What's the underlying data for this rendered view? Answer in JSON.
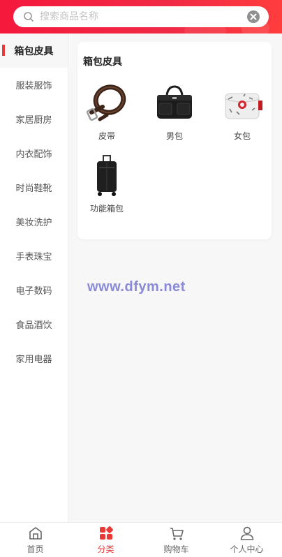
{
  "search": {
    "placeholder": "搜索商品名称",
    "value": ""
  },
  "sidebar": {
    "items": [
      {
        "label": "箱包皮具",
        "active": true
      },
      {
        "label": "服装服饰"
      },
      {
        "label": "家居厨房"
      },
      {
        "label": "内衣配饰"
      },
      {
        "label": "时尚鞋靴"
      },
      {
        "label": "美妆洗护"
      },
      {
        "label": "手表珠宝"
      },
      {
        "label": "电子数码"
      },
      {
        "label": "食品酒饮"
      },
      {
        "label": "家用电器"
      }
    ]
  },
  "main": {
    "title": "箱包皮具",
    "items": [
      {
        "name": "皮带",
        "icon": "belt-icon"
      },
      {
        "name": "男包",
        "icon": "mens-bag-icon"
      },
      {
        "name": "女包",
        "icon": "womens-bag-icon"
      },
      {
        "name": "功能箱包",
        "icon": "luggage-icon"
      }
    ]
  },
  "watermark": "www.dfym.net",
  "tabbar": {
    "items": [
      {
        "label": "首页",
        "icon": "home-icon"
      },
      {
        "label": "分类",
        "icon": "category-icon",
        "active": true
      },
      {
        "label": "购物车",
        "icon": "cart-icon"
      },
      {
        "label": "个人中心",
        "icon": "user-icon"
      }
    ]
  },
  "colors": {
    "accent": "#e93a3a",
    "header_start": "#f5193c",
    "header_end": "#ff3d3d"
  }
}
